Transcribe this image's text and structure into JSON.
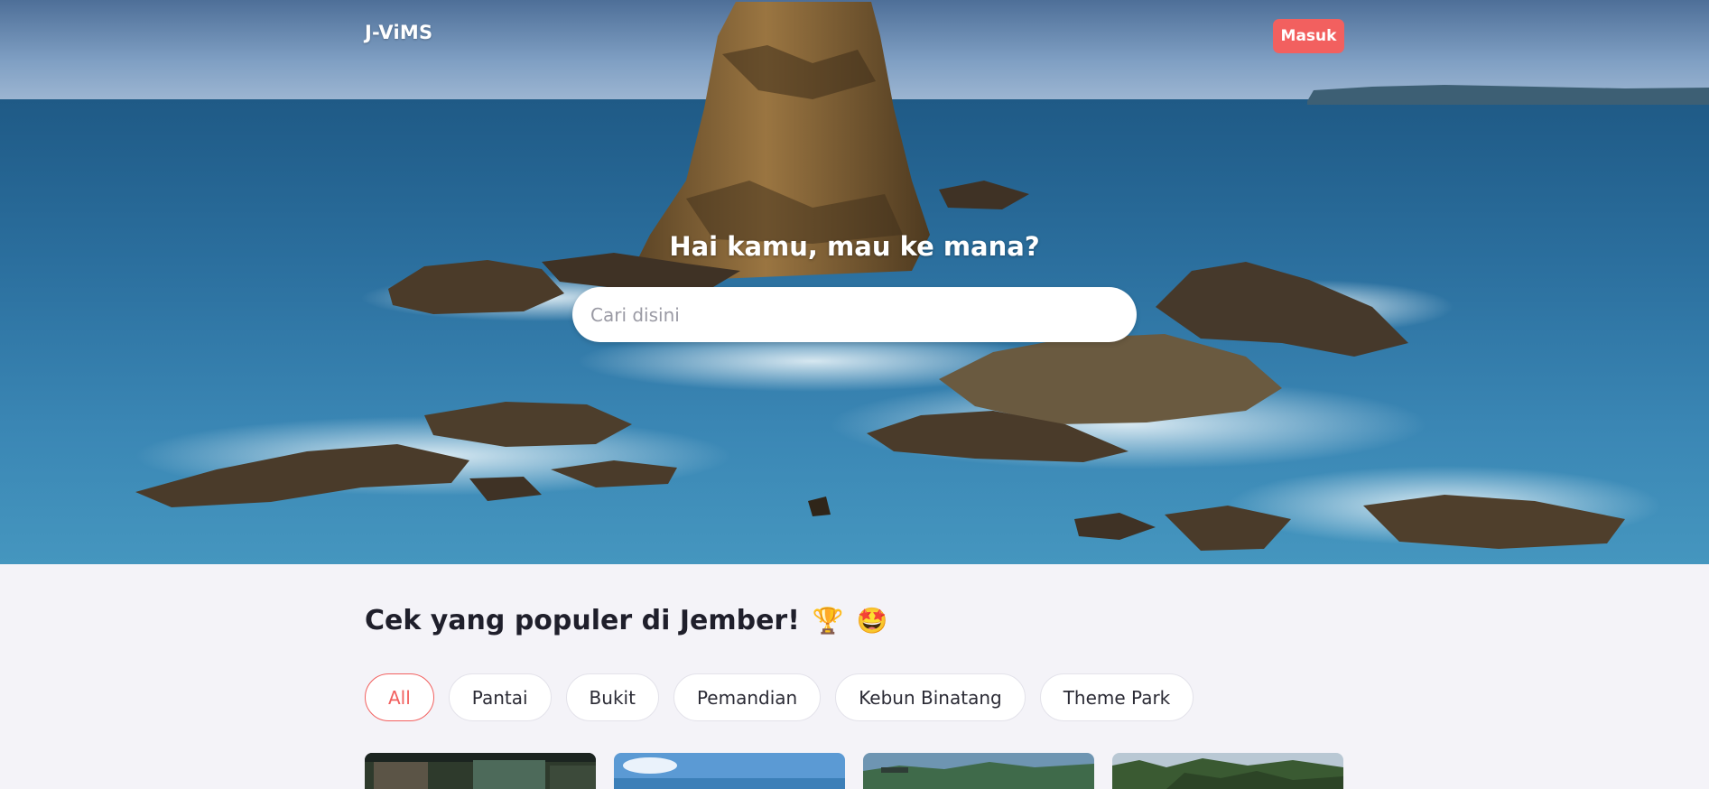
{
  "header": {
    "brand": "J-ViMS",
    "login_label": "Masuk"
  },
  "hero": {
    "title": "Hai kamu, mau ke mana?",
    "search_placeholder": "Cari disini"
  },
  "popular": {
    "title": "Cek yang populer di Jember!",
    "emojis": [
      "🏆",
      "🤩"
    ],
    "filters": [
      {
        "label": "All",
        "active": true
      },
      {
        "label": "Pantai",
        "active": false
      },
      {
        "label": "Bukit",
        "active": false
      },
      {
        "label": "Pemandian",
        "active": false
      },
      {
        "label": "Kebun Binatang",
        "active": false
      },
      {
        "label": "Theme Park",
        "active": false
      }
    ]
  },
  "colors": {
    "accent": "#f2605f",
    "page_bg": "#f4f3f8",
    "heading": "#1f1f2b"
  }
}
